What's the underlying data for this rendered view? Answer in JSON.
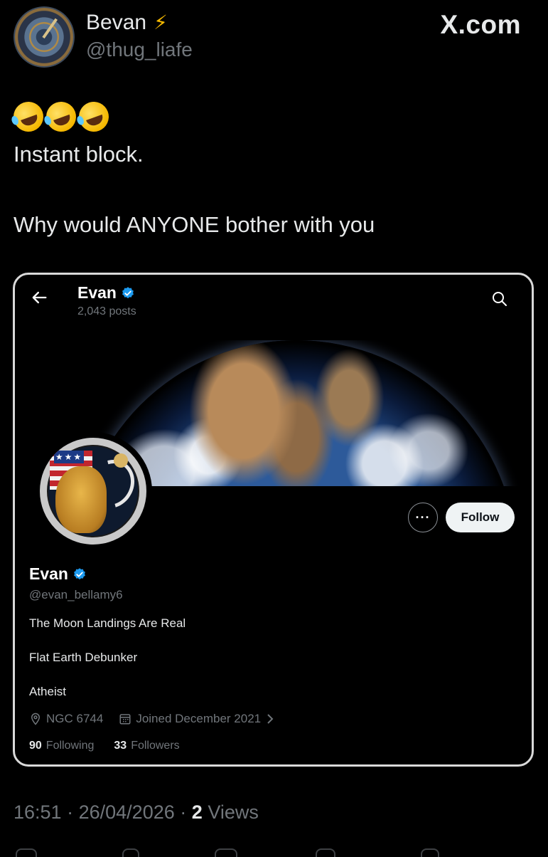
{
  "tweet": {
    "display_name": "Bevan",
    "badge_icon": "lightning-bolt-icon",
    "handle": "@thug_liafe",
    "watermark": "X.com",
    "emoji": [
      "rolling-on-floor-laughing-emoji",
      "rolling-on-floor-laughing-emoji",
      "rolling-on-floor-laughing-emoji"
    ],
    "line1": "Instant block.",
    "line2": "Why would ANYONE bother with you",
    "time": "16:51",
    "date": "26/04/2026",
    "views_count": "2",
    "views_label": "Views",
    "separator": "·"
  },
  "embedded_profile": {
    "header_name": "Evan",
    "posts": "2,043 posts",
    "name": "Evan",
    "handle": "@evan_bellamy6",
    "bio": [
      "The Moon Landings Are Real",
      "Flat Earth Debunker",
      "Atheist"
    ],
    "location": "NGC 6744",
    "joined": "Joined December 2021",
    "following_count": "90",
    "following_label": "Following",
    "followers_count": "33",
    "followers_label": "Followers",
    "follow_button": "Follow",
    "more_button": "···",
    "verified_color": "#1d9bf0"
  }
}
